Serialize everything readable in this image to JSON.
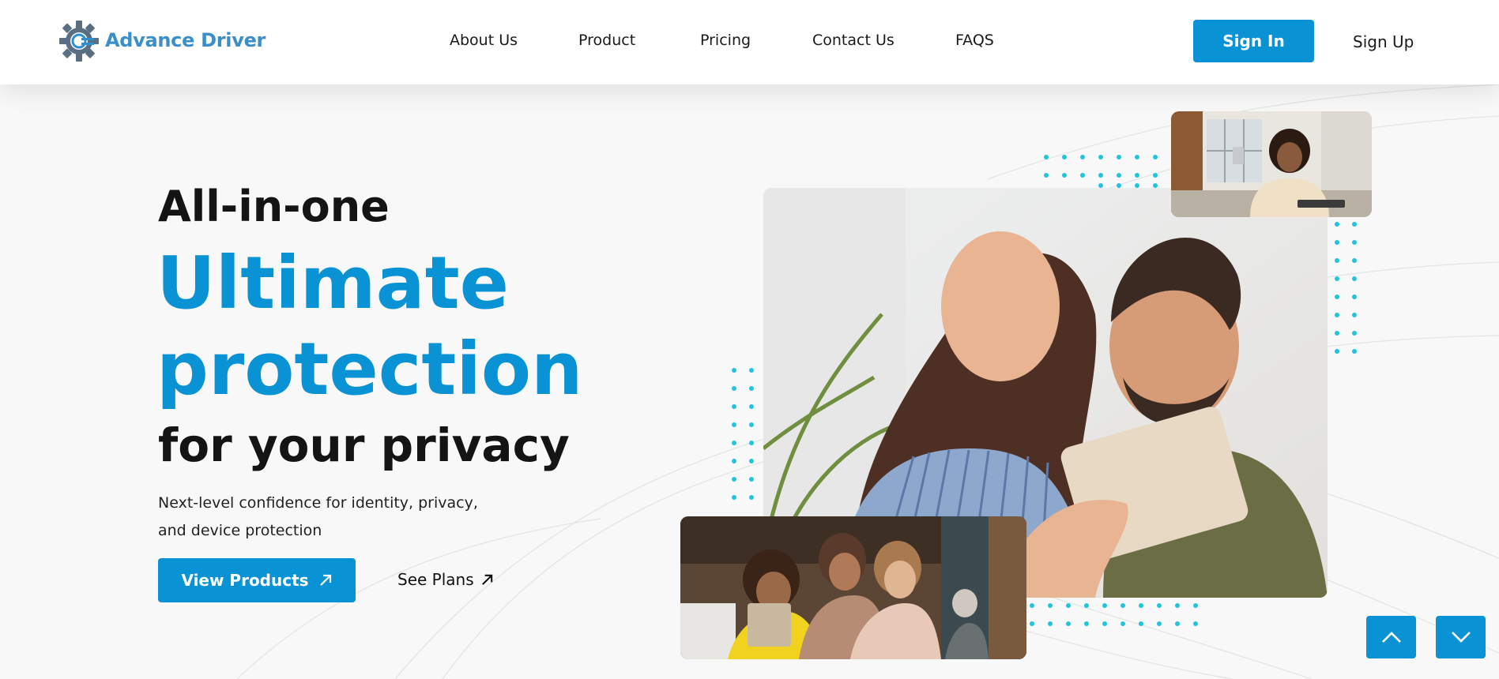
{
  "brand": {
    "name": "Advance Driver",
    "accent": "#0a93d4"
  },
  "nav": {
    "items": [
      {
        "label": "About Us"
      },
      {
        "label": "Product"
      },
      {
        "label": "Pricing"
      },
      {
        "label": "Contact Us"
      },
      {
        "label": "FAQS"
      }
    ],
    "sign_in": "Sign In",
    "sign_up": "Sign Up"
  },
  "hero": {
    "line1": "All-in-one",
    "line2": "Ultimate",
    "line3": "protection",
    "line4": "for your privacy",
    "subtitle_line1": "Next-level confidence for identity, privacy,",
    "subtitle_line2": "and device protection",
    "primary_cta": "View Products",
    "secondary_cta": "See Plans"
  },
  "images": {
    "main": "couple-with-tablet-photo",
    "top_right": "woman-with-card-photo",
    "bottom_left": "family-with-tablet-photo"
  },
  "icons": {
    "logo": "gear-logo-icon",
    "cta_arrow": "arrow-up-right-icon",
    "scroll_up": "chevron-up-icon",
    "scroll_down": "chevron-down-icon"
  }
}
